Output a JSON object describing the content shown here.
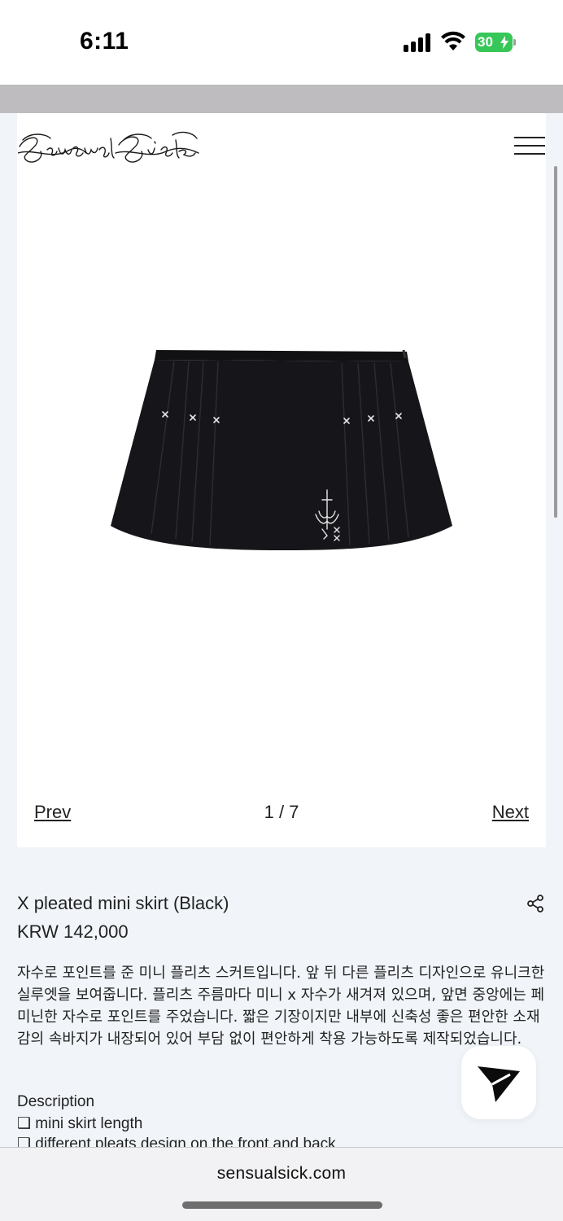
{
  "status_bar": {
    "time": "6:11",
    "battery": "30",
    "signal_icon": "cellular-signal-icon",
    "wifi_icon": "wifi-icon",
    "battery_color": "#37c759"
  },
  "header": {
    "logo_text": "SensualSick",
    "menu_icon": "hamburger-menu-icon"
  },
  "gallery": {
    "prev_label": "Prev",
    "counter": "1 / 7",
    "next_label": "Next"
  },
  "product": {
    "title": "X pleated mini skirt (Black)",
    "price": "KRW 142,000",
    "description": "자수로 포인트를 준 미니 플리츠 스커트입니다. 앞 뒤 다른 플리츠 디자인으로 유니크한 실루엣을 보여줍니다. 플리츠 주름마다 미니 x 자수가 새겨져 있으며, 앞면 중앙에는 페미닌한 자수로 포인트를 주었습니다. 짧은 기장이지만 내부에 신축성 좋은 편안한 소재감의 속바지가 내장되어 있어 부담 없이 편안하게 착용 가능하도록 제작되었습니다.",
    "section_heading": "Description",
    "bullets": [
      "❑ mini skirt length",
      "❑ different pleats design on the front and back"
    ],
    "share_icon": "share-icon"
  },
  "floating": {
    "send_icon": "paper-plane-icon"
  },
  "browser": {
    "url": "sensualsick.com"
  }
}
